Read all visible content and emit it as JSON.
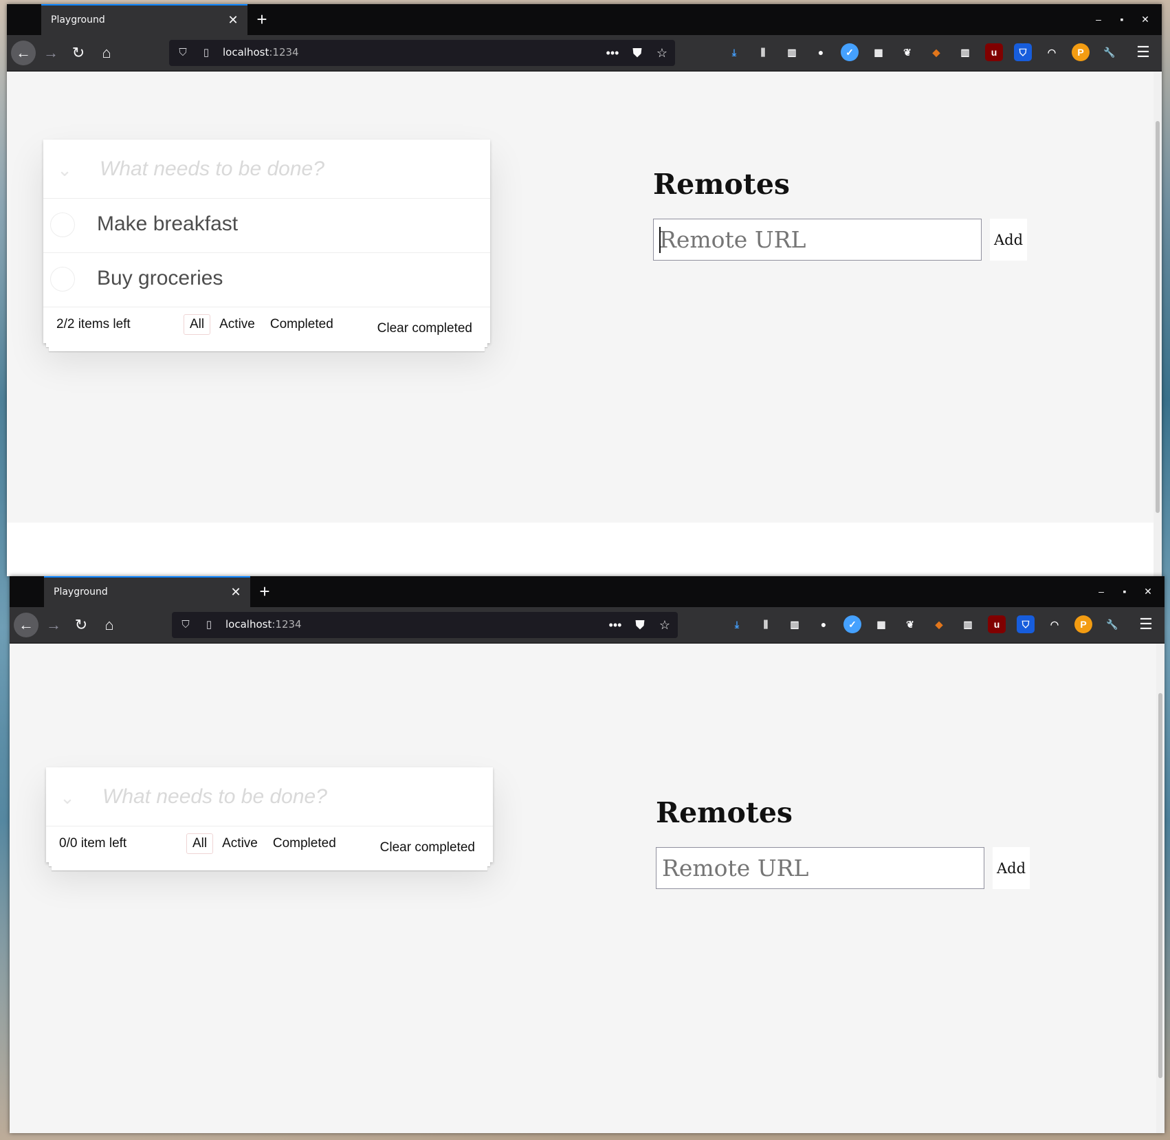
{
  "windows": [
    {
      "tab": {
        "title": "Playground"
      },
      "url": {
        "host": "localhost",
        "port": ":1234"
      },
      "todo": {
        "placeholder": "What needs to be done?",
        "items": [
          {
            "label": "Make breakfast",
            "completed": false
          },
          {
            "label": "Buy groceries",
            "completed": false
          }
        ],
        "count": "2/2 items left",
        "filters": {
          "all": "All",
          "active": "Active",
          "completed": "Completed"
        },
        "clear_completed": "Clear completed"
      },
      "remotes": {
        "title": "Remotes",
        "input_placeholder": "Remote URL",
        "add_label": "Add"
      }
    },
    {
      "tab": {
        "title": "Playground"
      },
      "url": {
        "host": "localhost",
        "port": ":1234"
      },
      "todo": {
        "placeholder": "What needs to be done?",
        "items": [],
        "count": "0/0 item left",
        "filters": {
          "all": "All",
          "active": "Active",
          "completed": "Completed"
        },
        "clear_completed": "Clear completed"
      },
      "remotes": {
        "title": "Remotes",
        "input_placeholder": "Remote URL",
        "add_label": "Add"
      }
    }
  ],
  "icons": {
    "toggle_all": "chevron-down-icon",
    "tab_close": "close-icon",
    "new_tab": "plus-icon"
  },
  "colors": {
    "accent": "#0a84ff",
    "toolbar": "#323234",
    "content_bg": "#f5f5f5",
    "filter_border": "#af2f2f"
  }
}
